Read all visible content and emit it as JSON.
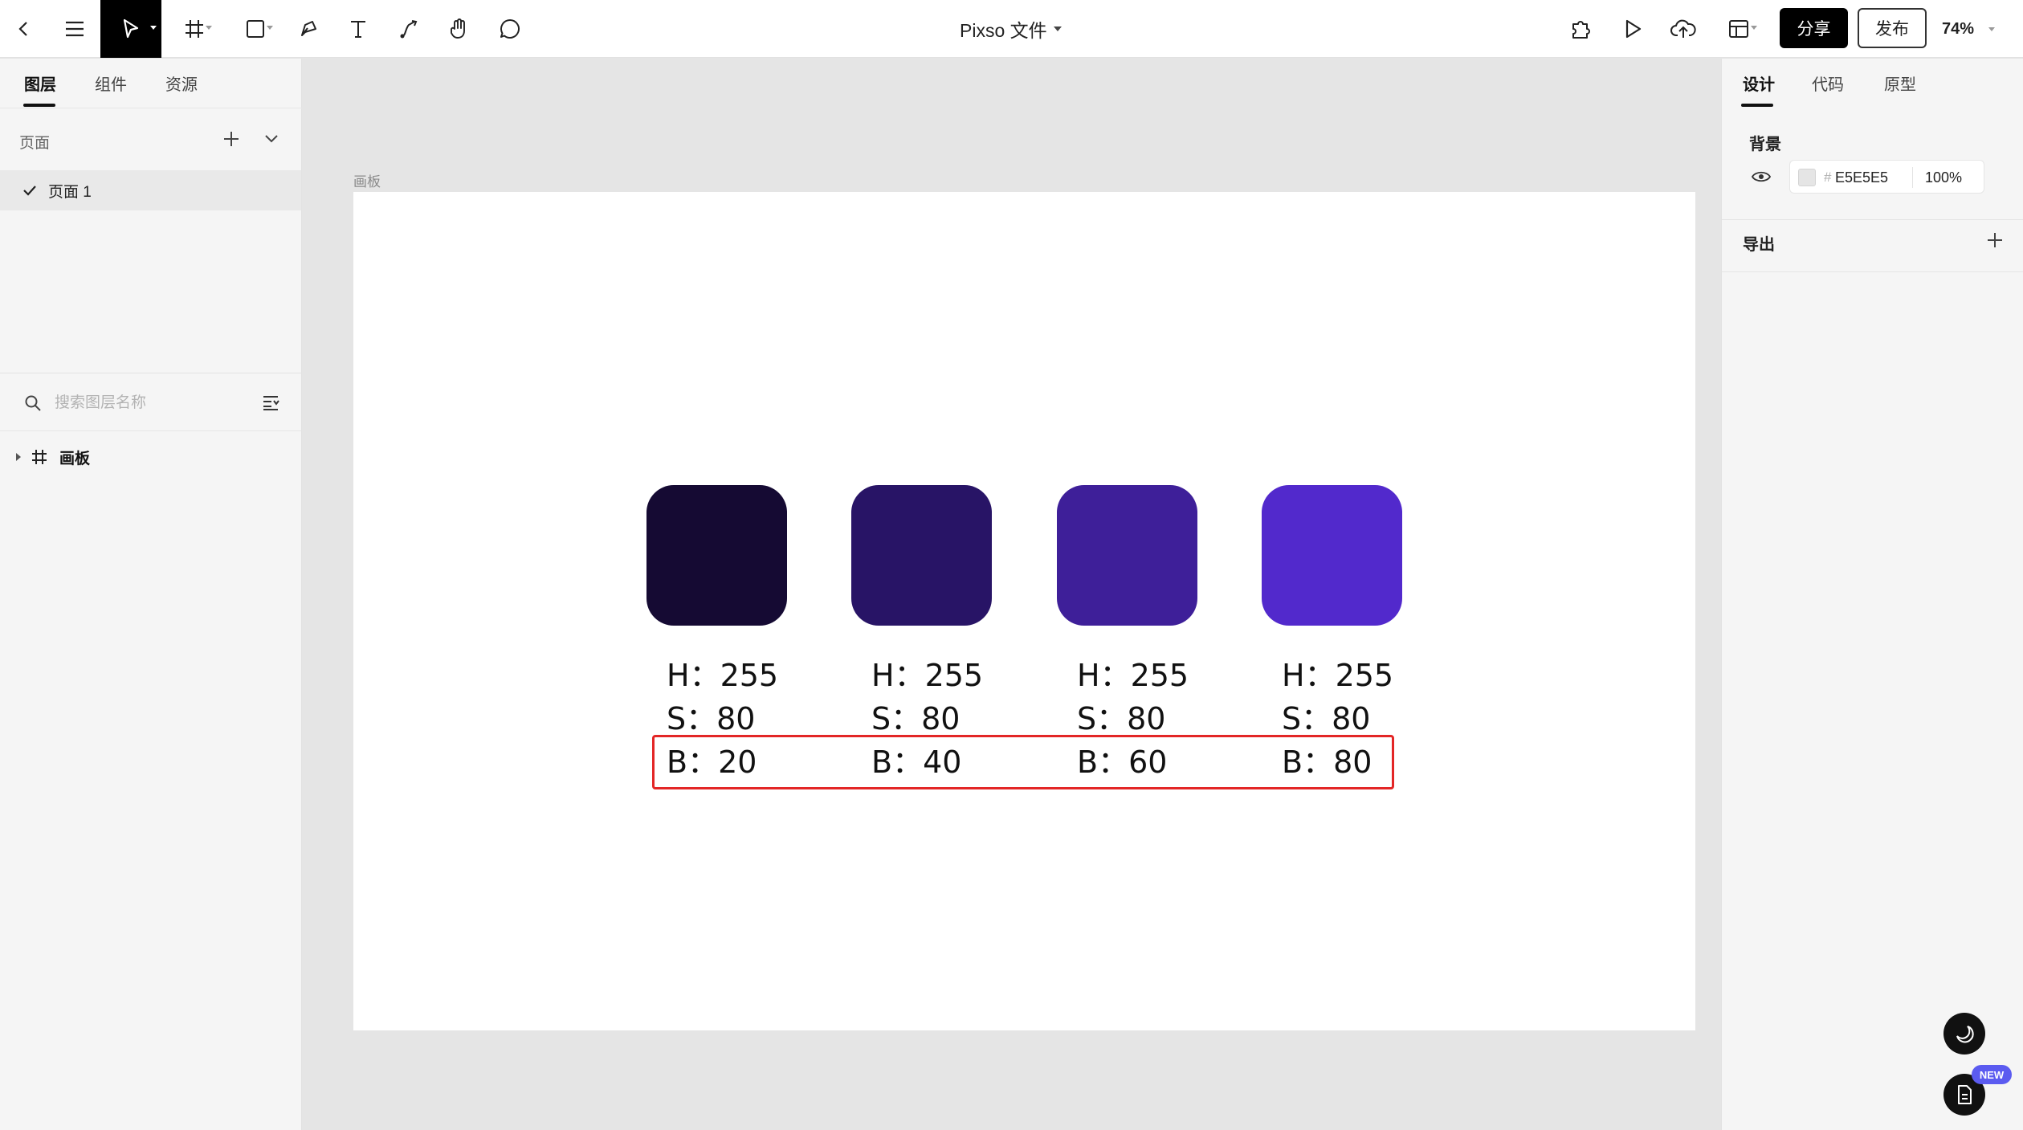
{
  "toolbar": {
    "doc_title": "Pixso 文件",
    "share_label": "分享",
    "publish_label": "发布",
    "zoom": "74%"
  },
  "left_panel": {
    "tabs": [
      "图层",
      "组件",
      "资源"
    ],
    "pages_header": "页面",
    "pages": [
      "页面 1"
    ],
    "search_placeholder": "搜索图层名称",
    "layers": [
      "画板"
    ]
  },
  "right_panel": {
    "tabs": [
      "设计",
      "代码",
      "原型"
    ],
    "background_header": "背景",
    "background_hex": "E5E5E5",
    "background_hash": "#",
    "background_opacity": "100%",
    "export_header": "导出",
    "new_badge": "NEW"
  },
  "canvas": {
    "frame_label": "画板",
    "swatches": [
      {
        "color": "#150a33",
        "h": "H：255",
        "s": "S：80",
        "b": "B：20"
      },
      {
        "color": "#281466",
        "h": "H：255",
        "s": "S：80",
        "b": "B：40"
      },
      {
        "color": "#3e1f99",
        "h": "H：255",
        "s": "S：80",
        "b": "B：60"
      },
      {
        "color": "#5229cc",
        "h": "H：255",
        "s": "S：80",
        "b": "B：80"
      }
    ],
    "highlight_color": "#e32626"
  }
}
